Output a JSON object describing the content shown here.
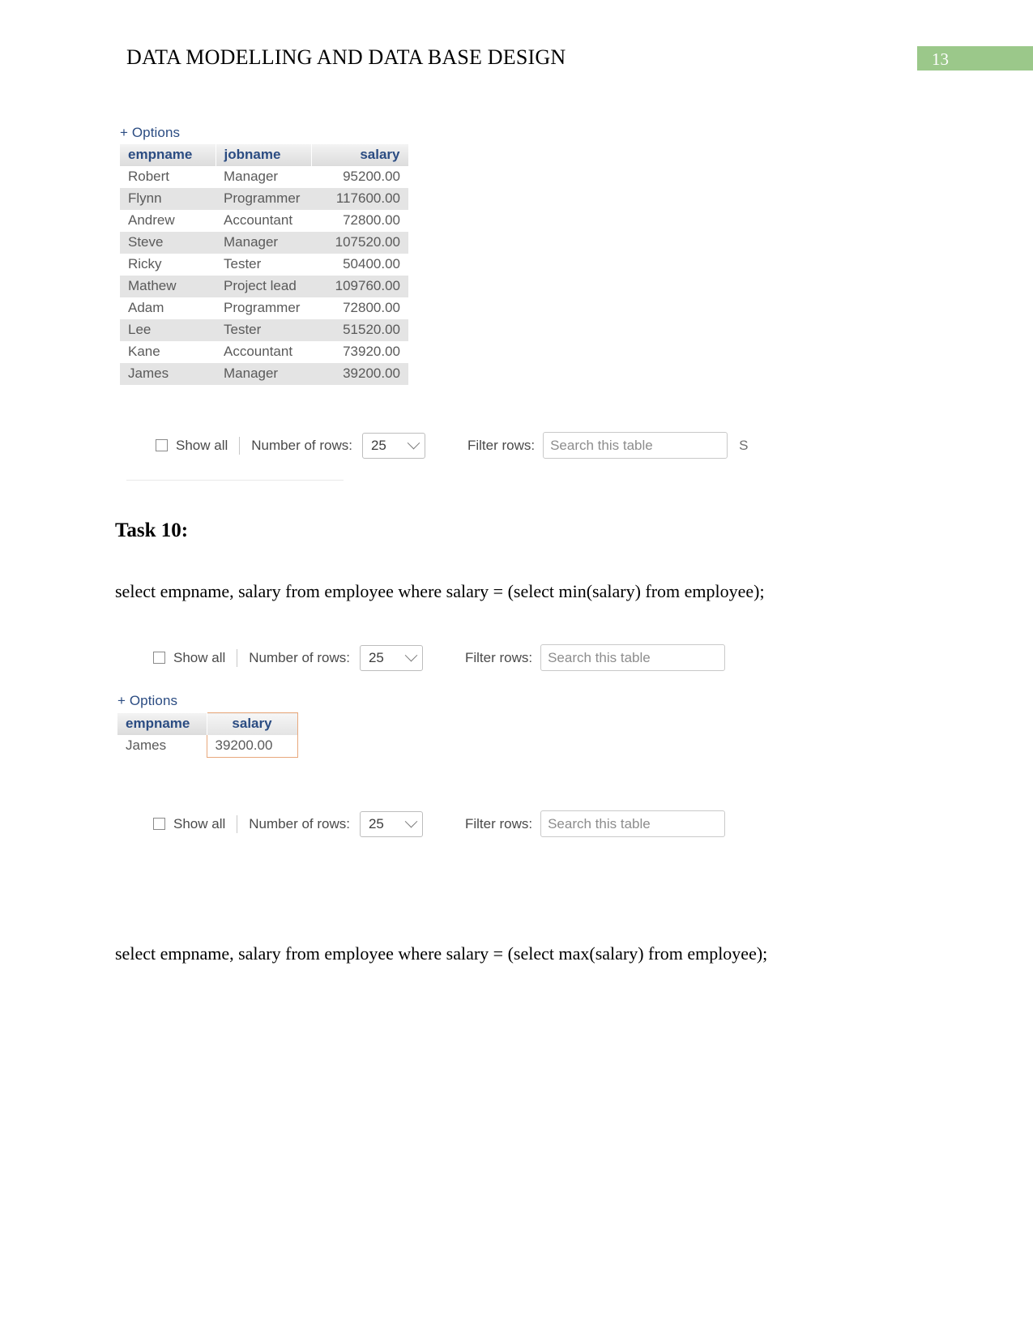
{
  "header": {
    "title": "DATA MODELLING AND DATA BASE DESIGN",
    "page_number": "13",
    "accent_color": "#9bc88a"
  },
  "result_block_1": {
    "options_label": "+ Options",
    "columns": [
      "empname",
      "jobname",
      "salary"
    ],
    "rows": [
      {
        "empname": "Robert",
        "jobname": "Manager",
        "salary": "95200.00"
      },
      {
        "empname": "Flynn",
        "jobname": "Programmer",
        "salary": "117600.00"
      },
      {
        "empname": "Andrew",
        "jobname": "Accountant",
        "salary": "72800.00"
      },
      {
        "empname": "Steve",
        "jobname": "Manager",
        "salary": "107520.00"
      },
      {
        "empname": "Ricky",
        "jobname": "Tester",
        "salary": "50400.00"
      },
      {
        "empname": "Mathew",
        "jobname": "Project lead",
        "salary": "109760.00"
      },
      {
        "empname": "Adam",
        "jobname": "Programmer",
        "salary": "72800.00"
      },
      {
        "empname": "Lee",
        "jobname": "Tester",
        "salary": "51520.00"
      },
      {
        "empname": "Kane",
        "jobname": "Accountant",
        "salary": "73920.00"
      },
      {
        "empname": "James",
        "jobname": "Manager",
        "salary": "39200.00"
      }
    ]
  },
  "controls_1": {
    "show_all_label": "Show all",
    "number_of_rows_label": "Number of rows:",
    "rows_value": "25",
    "filter_rows_label": "Filter rows:",
    "search_placeholder": "Search this table",
    "trailing_text": "S"
  },
  "task": {
    "heading": "Task 10:",
    "query_min": "select empname, salary from employee where salary = (select min(salary) from employee);",
    "query_max": "select empname, salary from employee where salary = (select max(salary) from employee);"
  },
  "controls_2": {
    "show_all_label": "Show all",
    "number_of_rows_label": "Number of rows:",
    "rows_value": "25",
    "filter_rows_label": "Filter rows:",
    "search_placeholder": "Search this table"
  },
  "result_block_2": {
    "options_label": "+ Options",
    "columns": [
      "empname",
      "salary"
    ],
    "highlight_color": "#e8a87c",
    "rows": [
      {
        "empname": "James",
        "salary": "39200.00"
      }
    ]
  },
  "controls_3": {
    "show_all_label": "Show all",
    "number_of_rows_label": "Number of rows:",
    "rows_value": "25",
    "filter_rows_label": "Filter rows:",
    "search_placeholder": "Search this table"
  }
}
